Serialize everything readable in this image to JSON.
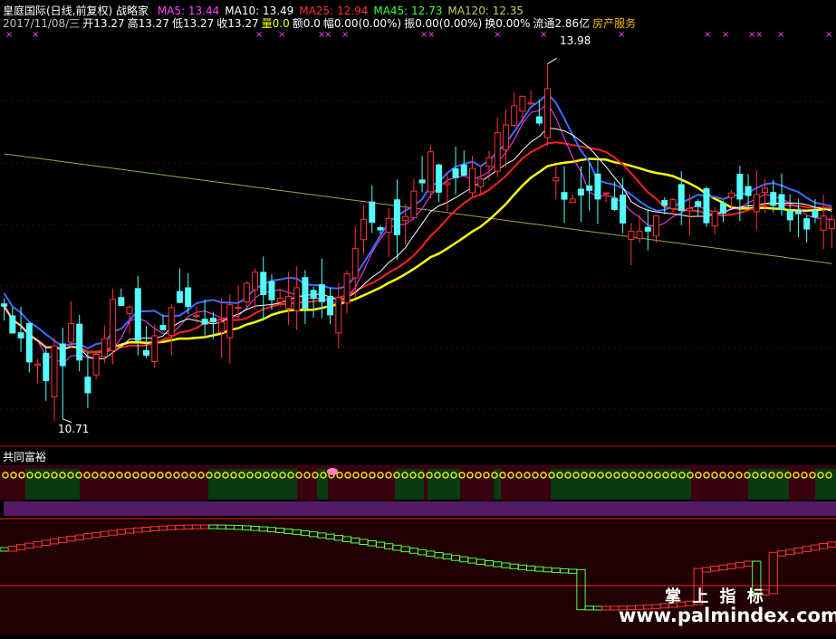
{
  "header": {
    "title": "皇庭国际(日线,前复权) 战略家",
    "ma": [
      {
        "label": "MA5: 13.44",
        "color": "#ff3cff"
      },
      {
        "label": "MA10: 13.49",
        "color": "#ffffff"
      },
      {
        "label": "MA25: 12.94",
        "color": "#ff3030"
      },
      {
        "label": "MA45: 12.73",
        "color": "#3cff3c"
      },
      {
        "label": "MA120: 12.35",
        "color": "#c8c864"
      }
    ],
    "quote": [
      {
        "text": "2017/11/08/三",
        "color": "#c0c0c0"
      },
      {
        "text": "开13.27",
        "color": "#ffffff"
      },
      {
        "text": "高13.27",
        "color": "#ffffff"
      },
      {
        "text": "低13.27",
        "color": "#ffffff"
      },
      {
        "text": "收13.27",
        "color": "#ffffff"
      },
      {
        "text": "量0.0",
        "color": "#ffff00"
      },
      {
        "text": "额0.0",
        "color": "#ffffff"
      },
      {
        "text": "幅0.00(0.00%)",
        "color": "#ffffff"
      },
      {
        "text": "振0.00(0.00%)",
        "color": "#ffffff"
      },
      {
        "text": "换0.00%",
        "color": "#ffffff"
      },
      {
        "text": "流通2.86亿",
        "color": "#ffffff"
      },
      {
        "text": "房产服务",
        "color": "#ffb400"
      }
    ]
  },
  "annotations": {
    "high": "13.98",
    "low": "10.71"
  },
  "sub_panel": {
    "title": "共同富裕"
  },
  "watermark": {
    "cn": "掌 上 指 标",
    "url": "www.palmindex.com"
  },
  "colors": {
    "up": "#ff3232",
    "down": "#54fcfc",
    "ma_blue": "#3c6cff",
    "yellow": "#ffff00",
    "wave_up": "#ff3232",
    "wave_down": "#50ff50"
  },
  "chart_data": {
    "type": "candlestick",
    "ylim": [
      10.5,
      14.2
    ],
    "price_low": 10.71,
    "price_high": 13.98,
    "close_path": [
      11.75,
      11.55,
      11.4,
      11.2,
      11.1,
      11.5,
      11.6,
      11.2,
      10.95,
      11.5,
      11.7,
      11.8,
      11.6,
      11.3,
      11.5,
      11.7,
      11.9,
      11.8,
      11.6,
      11.5,
      11.7,
      11.8,
      11.9,
      11.95,
      11.85,
      11.8,
      11.9,
      11.85,
      11.75,
      11.7,
      11.6,
      11.9,
      12.3,
      12.5,
      12.6,
      12.55,
      12.5,
      12.6,
      12.9,
      13.1,
      12.9,
      12.8,
      13.0,
      13.1,
      13.0,
      13.2,
      13.4,
      13.7,
      13.85,
      13.4,
      13.1,
      12.8,
      12.7,
      12.9,
      12.8,
      12.75,
      12.7,
      12.6,
      12.5,
      12.55,
      12.6,
      12.7,
      12.75,
      12.6,
      12.55,
      12.5,
      12.6,
      12.75,
      12.7,
      12.8,
      12.7,
      12.6,
      12.55,
      12.5,
      12.6,
      12.55,
      12.5
    ]
  }
}
